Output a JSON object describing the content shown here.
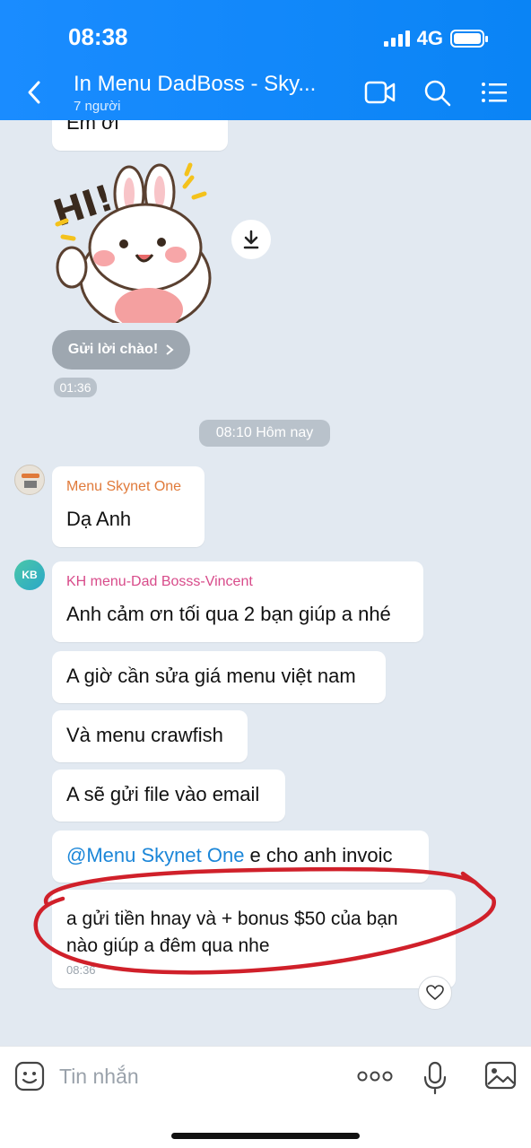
{
  "status": {
    "time": "08:38",
    "network": "4G"
  },
  "header": {
    "title": "In Menu DadBoss - Sky...",
    "subtitle": "7 người"
  },
  "messages": {
    "first_partial": "Em ơi",
    "greeting_button": "Gửi lời chào!",
    "sticker_time": "01:36",
    "date_divider": "08:10 Hôm nay",
    "msg1": {
      "sender": "Menu Skynet One",
      "text": "Dạ Anh",
      "sender_color": "#e07a3a"
    },
    "avatar2_initials": "KB",
    "msg2": {
      "sender": "KH menu-Dad Bosss-Vincent",
      "text": "Anh cảm ơn tối qua 2 bạn giúp a nhé",
      "sender_color": "#d84b8a"
    },
    "msg3": "A giờ cần sửa giá menu việt nam",
    "msg4": "Và menu crawfish",
    "msg5": "A sẽ gửi file vào email",
    "msg6": {
      "mention": "@Menu Skynet One",
      "text": " e cho anh invoic"
    },
    "msg7": {
      "line1": "a gửi tiền hnay và + bonus $50 của bạn",
      "line2": "nào giúp a đêm qua nhe",
      "time": "08:36"
    }
  },
  "input": {
    "placeholder": "Tin nhắn"
  },
  "colors": {
    "header": "#1a8cff",
    "annotation": "#d0202a",
    "mention": "#1b86d8"
  }
}
